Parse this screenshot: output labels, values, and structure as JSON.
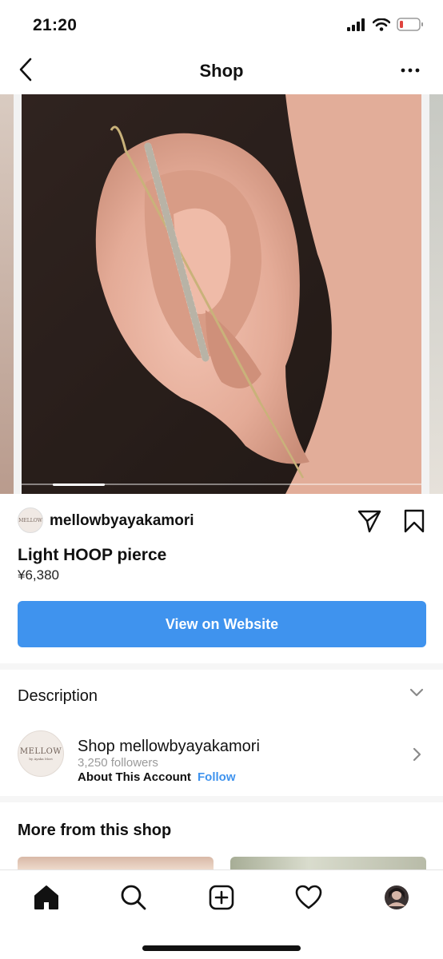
{
  "status_bar": {
    "time": "21:20",
    "battery_low_color": "#e0443e"
  },
  "nav": {
    "title": "Shop",
    "back_icon": "chevron-left-icon",
    "more_icon": "more-horizontal-icon"
  },
  "carousel": {
    "current_slide": 1,
    "image_subject": "ear-with-crystal-bar-earring"
  },
  "seller": {
    "avatar_text": "MELLOW",
    "name": "mellowbyayakamori"
  },
  "product": {
    "name": "Light HOOP pierce",
    "price": "¥6,380"
  },
  "cta": {
    "label": "View on Website",
    "color": "#3f93ee"
  },
  "description": {
    "label": "Description"
  },
  "account": {
    "avatar_text": "MELLOW",
    "avatar_subtext": "by Ayaka Mori",
    "title": "Shop mellowbyayakamori",
    "followers": "3,250 followers",
    "about": "About This Account",
    "follow": "Follow"
  },
  "more_from_shop": {
    "title": "More from this shop"
  },
  "tab_bar": {
    "items": [
      {
        "name": "home",
        "icon": "home-icon",
        "active": true
      },
      {
        "name": "search",
        "icon": "search-icon"
      },
      {
        "name": "create",
        "icon": "plus-square-icon"
      },
      {
        "name": "activity",
        "icon": "heart-icon"
      },
      {
        "name": "profile",
        "icon": "avatar"
      }
    ]
  }
}
